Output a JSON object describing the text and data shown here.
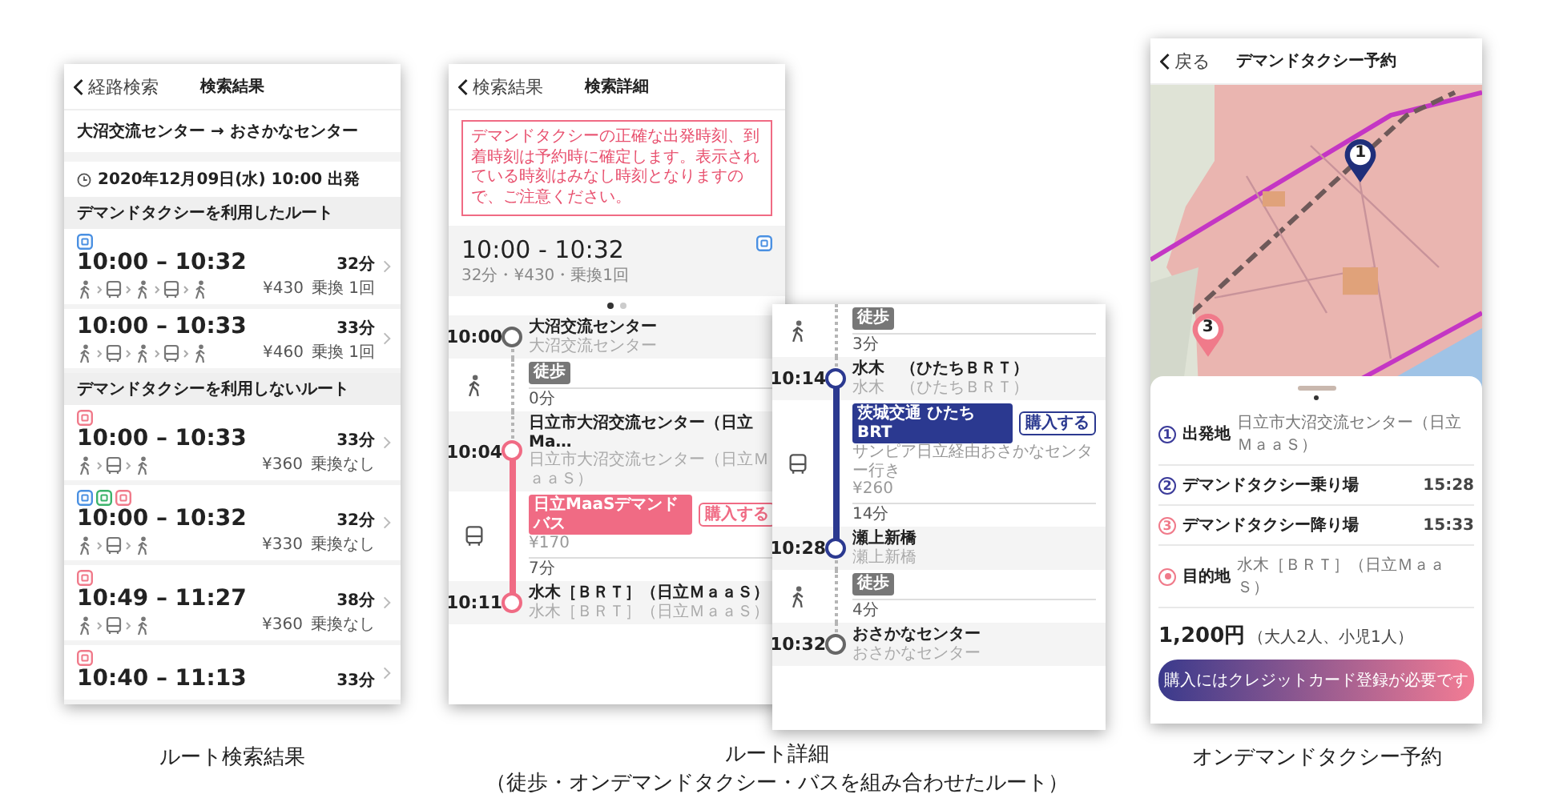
{
  "route_results": {
    "back_label": "経路検索",
    "title": "検索結果",
    "route": "大沼交流センター → おさかなセンター",
    "departure": "2020年12月09日(水) 10:00 出発",
    "sections": [
      {
        "heading": "デマンドタクシーを利用したルート",
        "routes": [
          {
            "tags": [
              {
                "color": "#4a90e2"
              }
            ],
            "time": "10:00 – 10:32",
            "duration": "32分",
            "legs": [
              {
                "kind": "walk"
              },
              {
                "kind": "bus"
              },
              {
                "kind": "walk"
              },
              {
                "kind": "bus"
              },
              {
                "kind": "walk"
              }
            ],
            "fare": "¥430",
            "transfers": "乗換 1回"
          },
          {
            "time": "10:00 – 10:33",
            "duration": "33分",
            "legs": [
              {
                "kind": "walk"
              },
              {
                "kind": "bus"
              },
              {
                "kind": "walk"
              },
              {
                "kind": "bus"
              },
              {
                "kind": "walk"
              }
            ],
            "fare": "¥460",
            "transfers": "乗換 1回"
          }
        ]
      },
      {
        "heading": "デマンドタクシーを利用しないルート",
        "routes": [
          {
            "tags": [
              {
                "color": "#f07a8a"
              }
            ],
            "time": "10:00 – 10:33",
            "duration": "33分",
            "legs": [
              {
                "kind": "walk"
              },
              {
                "kind": "bus"
              },
              {
                "kind": "walk"
              }
            ],
            "fare": "¥360",
            "transfers": "乗換なし"
          },
          {
            "tags": [
              {
                "color": "#4a90e2"
              },
              {
                "color": "#3bb36a"
              },
              {
                "color": "#f07a8a"
              }
            ],
            "time": "10:00 – 10:32",
            "duration": "32分",
            "legs": [
              {
                "kind": "walk"
              },
              {
                "kind": "bus"
              },
              {
                "kind": "walk"
              }
            ],
            "fare": "¥330",
            "transfers": "乗換なし"
          },
          {
            "tags": [
              {
                "color": "#f07a8a"
              }
            ],
            "time": "10:49 – 11:27",
            "duration": "38分",
            "legs": [
              {
                "kind": "walk"
              },
              {
                "kind": "bus"
              },
              {
                "kind": "walk"
              }
            ],
            "fare": "¥360",
            "transfers": "乗換なし"
          },
          {
            "tags": [
              {
                "color": "#f07a8a"
              }
            ],
            "time": "10:40 – 11:13",
            "duration": "33分"
          }
        ]
      }
    ],
    "caption": "ルート検索結果"
  },
  "route_detail": {
    "back_label": "検索結果",
    "title": "検索詳細",
    "notice": "デマンドタクシーの正確な出発時刻、到着時刻は予約時に確定します。表示されている時刻はみなし時刻となりますので、ご注意ください。",
    "summary": {
      "time": "10:00 - 10:32",
      "info": "32分・¥430・乗換1回",
      "tag": {
        "color": "#4a90e2"
      }
    },
    "pages": [
      {
        "selected": true
      },
      {
        "selected": false
      }
    ],
    "timeline": [
      {
        "kind": "stop",
        "time": "10:00",
        "name": "大沼交流センター",
        "sub": "大沼交流センター",
        "color": "#666666"
      },
      {
        "kind": "walk",
        "badge": "徒歩",
        "duration": "0分"
      },
      {
        "kind": "stop",
        "time": "10:04",
        "name": "日立市大沼交流センター（日立Ma…",
        "sub": "日立市大沼交流センター（日立ＭａａＳ）",
        "color": "#f06b84"
      },
      {
        "kind": "bus",
        "badge": "日立MaaSデマンドバス",
        "button": "購入する",
        "fare": "¥170",
        "duration": "7分",
        "color": "#f06b84"
      },
      {
        "kind": "stop",
        "time": "10:11",
        "name": "水木［ＢＲＴ］（日立ＭａａＳ）",
        "sub": "水木［ＢＲＴ］（日立ＭａａＳ）",
        "color": "#f06b84"
      }
    ],
    "caption": {
      "title": "ルート詳細",
      "subtitle": "（徒歩・オンデマンドタクシー・バスを組み合わせたルート）"
    }
  },
  "route_detail_continued": {
    "timeline": [
      {
        "kind": "walk",
        "badge": "徒歩",
        "duration": "3分"
      },
      {
        "kind": "stop",
        "time": "10:14",
        "name": "水木　（ひたちＢＲＴ）",
        "sub": "水木　（ひたちＢＲＴ）",
        "color": "#2b3990"
      },
      {
        "kind": "bus",
        "badge": "茨城交通 ひたちBRT",
        "button": "購入する",
        "destination": "サンピア日立経由おさかなセンター行き",
        "fare": "¥260",
        "duration": "14分",
        "color": "#2b3990"
      },
      {
        "kind": "stop",
        "time": "10:28",
        "name": "瀬上新橋",
        "sub": "瀬上新橋",
        "color": "#2b3990"
      },
      {
        "kind": "walk",
        "badge": "徒歩",
        "duration": "4分"
      },
      {
        "kind": "stop",
        "time": "10:32",
        "name": "おさかなセンター",
        "sub": "おさかなセンター",
        "color": "#666666"
      }
    ]
  },
  "taxi_booking": {
    "back_label": "戻る",
    "title": "デマンドタクシー予約",
    "pins": [
      {
        "label": "1",
        "color": "#1f2f7a"
      },
      {
        "label": "3",
        "color": "#f07a8a"
      }
    ],
    "stops": [
      {
        "kind": "numbered",
        "marker": "1",
        "label": "出発地",
        "value": "日立市大沼交流センター（日立ＭａａＳ）",
        "color": "#3b3b9a"
      },
      {
        "kind": "numbered",
        "marker": "2",
        "label": "デマンドタクシー乗り場",
        "time": "15:28",
        "color": "#3b3b9a"
      },
      {
        "kind": "numbered",
        "marker": "3",
        "label": "デマンドタクシー降り場",
        "time": "15:33",
        "color": "#f07a8a"
      },
      {
        "kind": "destination",
        "label": "目的地",
        "value": "水木［ＢＲＴ］（日立ＭａａＳ）",
        "color": "#f07a8a"
      }
    ],
    "price": "1,200円",
    "price_note": "（大人2人、小児1人）",
    "button": "購入にはクレジットカード登録が必要です",
    "caption": "オンデマンドタクシー予約"
  }
}
